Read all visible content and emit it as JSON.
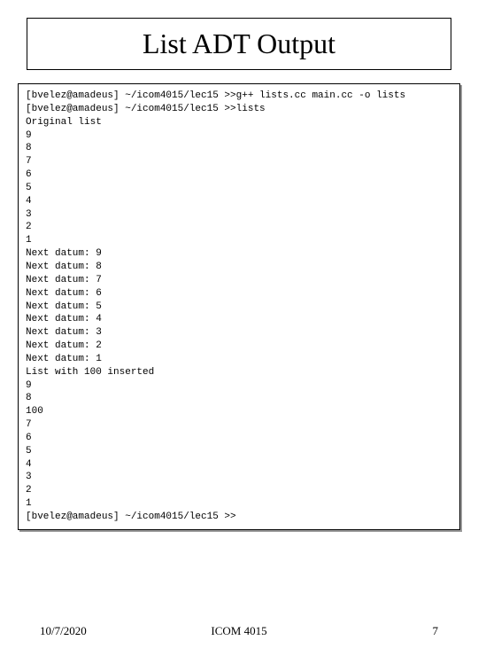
{
  "title": "List ADT Output",
  "terminal_output": "[bvelez@amadeus] ~/icom4015/lec15 >>g++ lists.cc main.cc -o lists\n[bvelez@amadeus] ~/icom4015/lec15 >>lists\nOriginal list\n9\n8\n7\n6\n5\n4\n3\n2\n1\nNext datum: 9\nNext datum: 8\nNext datum: 7\nNext datum: 6\nNext datum: 5\nNext datum: 4\nNext datum: 3\nNext datum: 2\nNext datum: 1\nList with 100 inserted\n9\n8\n100\n7\n6\n5\n4\n3\n2\n1\n[bvelez@amadeus] ~/icom4015/lec15 >>",
  "footer": {
    "date": "10/7/2020",
    "course": "ICOM 4015",
    "page": "7"
  }
}
